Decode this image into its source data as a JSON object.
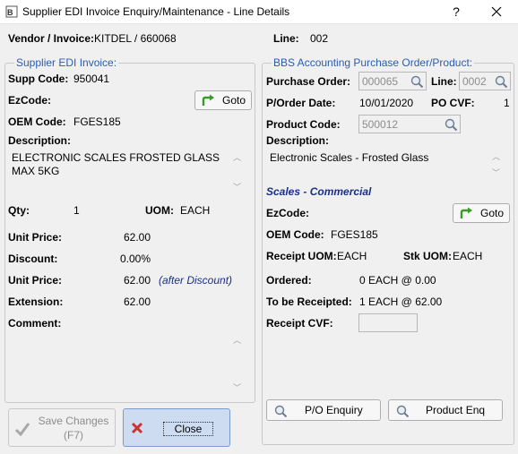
{
  "window": {
    "title": "Supplier EDI Invoice Enquiry/Maintenance - Line Details",
    "help_glyph": "?",
    "close_glyph": "✕"
  },
  "header": {
    "vendor_invoice_label": "Vendor / Invoice:",
    "vendor_invoice_value": "KITDEL / 660068",
    "line_label": "Line:",
    "line_value": "002"
  },
  "edi": {
    "legend": "Supplier EDI Invoice:",
    "supp_code_label": "Supp Code:",
    "supp_code_value": "950041",
    "ezcode_label": "EzCode:",
    "goto_label": "Goto",
    "oem_code_label": "OEM Code:",
    "oem_code_value": "FGES185",
    "description_label": "Description:",
    "description_value": "ELECTRONIC SCALES FROSTED GLASS\nMAX 5KG",
    "qty_label": "Qty:",
    "qty_value": "1",
    "uom_label": "UOM:",
    "uom_value": "EACH",
    "unit_price_label": "Unit Price:",
    "unit_price_value": "62.00",
    "discount_label": "Discount:",
    "discount_value": "0.00%",
    "unit_price2_label": "Unit Price:",
    "unit_price2_value": "62.00",
    "after_discount_note": "(after Discount)",
    "extension_label": "Extension:",
    "extension_value": "62.00",
    "comment_label": "Comment:",
    "comment_value": ""
  },
  "po": {
    "legend": "BBS Accounting Purchase Order/Product:",
    "purchase_order_label": "Purchase Order:",
    "purchase_order_value": "000065",
    "line_label": "Line:",
    "line_value": "0002",
    "po_date_label": "P/Order Date:",
    "po_date_value": "10/01/2020",
    "po_cvf_label": "PO CVF:",
    "po_cvf_value": "1",
    "product_code_label": "Product Code:",
    "product_code_value": "500012",
    "description_label": "Description:",
    "description_value": "Electronic Scales - Frosted Glass",
    "category_title": "Scales - Commercial",
    "ezcode_label": "EzCode:",
    "goto_label": "Goto",
    "oem_code_label": "OEM Code:",
    "oem_code_value": "FGES185",
    "receipt_uom_label": "Receipt UOM:",
    "receipt_uom_value": "EACH",
    "stk_uom_label": "Stk UOM:",
    "stk_uom_value": "EACH",
    "ordered_label": "Ordered:",
    "ordered_value": "0 EACH @ 0.00",
    "to_be_receipted_label": "To be Receipted:",
    "to_be_receipted_value": "1 EACH @ 62.00",
    "receipt_cvf_label": "Receipt CVF:",
    "receipt_cvf_value": "",
    "po_enquiry_label": "P/O Enquiry",
    "product_enq_label": "Product Enq"
  },
  "footer": {
    "save_changes_line1": "Save Changes",
    "save_changes_line2": "(F7)",
    "close_label": "Close"
  },
  "colors": {
    "legend_blue": "#2a5db0",
    "section_blue": "#1a2f86",
    "goto_arrow_green": "#3a9a2a",
    "close_red": "#d03030",
    "close_bg": "#cddcf0"
  }
}
